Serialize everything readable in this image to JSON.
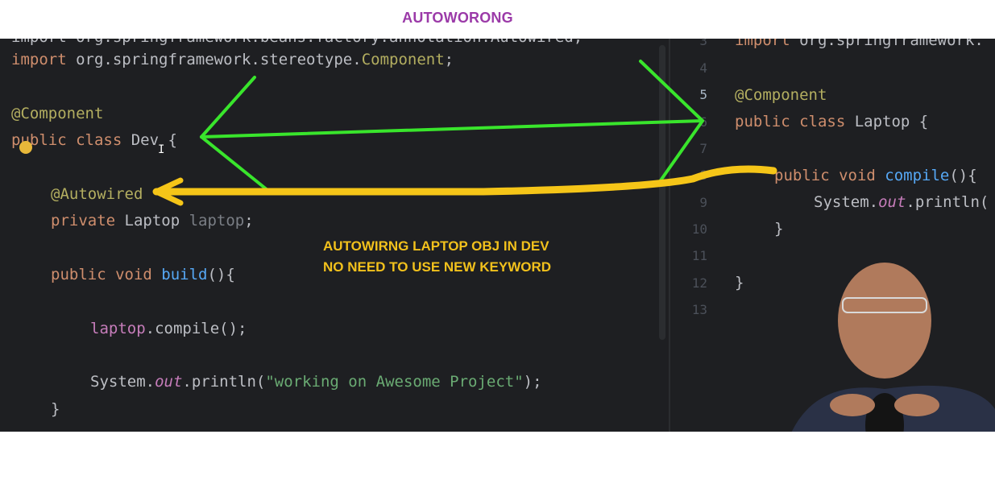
{
  "header": {
    "title": "AUTOWORONG"
  },
  "left_editor": {
    "line_top_cut": "import org.springframework.beans.factory.annotation.Autowired;",
    "import_kw": "import",
    "import_path": " org.springframework.stereotype.",
    "import_class": "Component",
    "semicolon": ";",
    "ann_component": "@Component",
    "public_kw": "public class",
    "class_name": " Dev",
    "brace_open": " {",
    "ann_autowired": "@Autowired",
    "private_kw": "private",
    "laptop_type": " Laptop",
    "laptop_field": " laptop",
    "method_kw": "public void",
    "method_name": " build",
    "method_parens": "(){",
    "call_obj": "laptop",
    "call_rest": ".compile();",
    "sysout_a": "System.",
    "sysout_out": "out",
    "sysout_b": ".println(",
    "sysout_str": "\"working on Awesome Project\"",
    "sysout_c": ");",
    "brace_close": "}"
  },
  "right_editor": {
    "line_numbers": [
      "3",
      "4",
      "5",
      "6",
      "7",
      "8",
      "9",
      "10",
      "11",
      "12",
      "13"
    ],
    "import_kw": "import",
    "import_path": " org.springframework.",
    "ann_component": "@Component",
    "public_kw": "public class",
    "class_name": " Laptop",
    "brace_open": " {",
    "method_kw": "public void",
    "method_name": " compile",
    "method_parens": "(){",
    "sysout_a": "System.",
    "sysout_out": "out",
    "sysout_b": ".println(",
    "inner_close": "}",
    "outer_close": "}"
  },
  "annotation": {
    "line1": "AUTOWIRNG LAPTOP OBJ IN DEV",
    "line2": "NO NEED TO USE NEW KEYWORD"
  },
  "colors": {
    "title": "#9b3aa8",
    "editor_bg": "#1e1f22",
    "green_arrow": "#39e52c",
    "yellow_arrow": "#f5c518",
    "note_text": "#f2c11c"
  },
  "icons": [
    "lightbulb-icon",
    "text-cursor-icon"
  ]
}
